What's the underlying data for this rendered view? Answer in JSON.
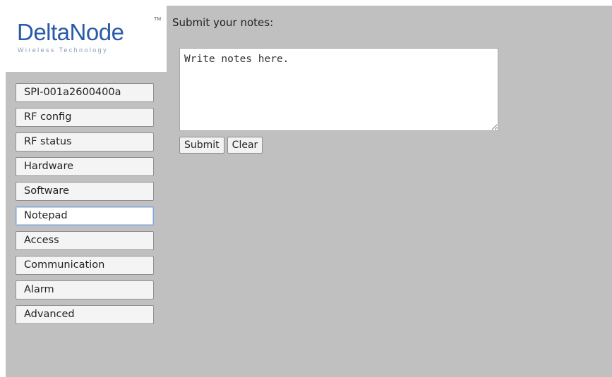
{
  "logo": {
    "brand_part1": "Delta",
    "brand_part2": "Node",
    "trademark": "TM",
    "tagline": "Wireless Technology"
  },
  "nav": {
    "items": [
      {
        "label": "SPI-001a2600400a"
      },
      {
        "label": "RF config"
      },
      {
        "label": "RF status"
      },
      {
        "label": "Hardware"
      },
      {
        "label": "Software"
      },
      {
        "label": "Notepad",
        "active": true
      },
      {
        "label": "Access"
      },
      {
        "label": "Communication"
      },
      {
        "label": "Alarm"
      },
      {
        "label": "Advanced"
      }
    ]
  },
  "notepad": {
    "heading": "Submit your notes:",
    "textarea_value": "Write notes here.",
    "submit_label": "Submit",
    "clear_label": "Clear"
  },
  "colors": {
    "background": "#c0c0c0",
    "logo_blue": "#2a5aa8",
    "active_border": "#7ea5d8"
  }
}
